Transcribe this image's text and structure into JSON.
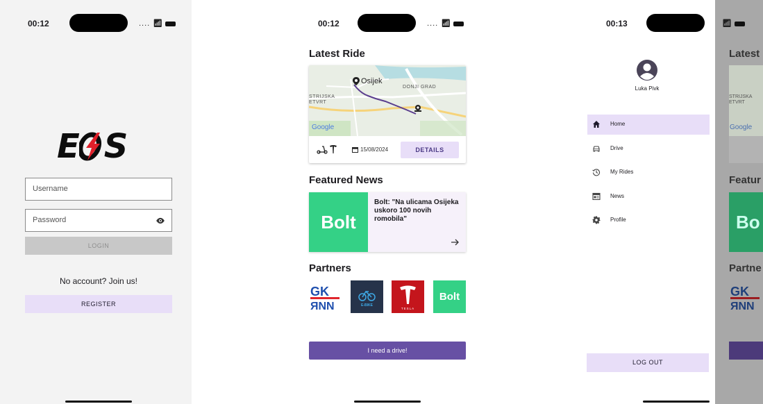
{
  "screens": {
    "login": {
      "status_time": "00:12",
      "logo_left": "E",
      "logo_right": "S",
      "username_placeholder": "Username",
      "password_placeholder": "Password",
      "login_label": "LOGIN",
      "join_text": "No account? Join us!",
      "register_label": "REGISTER"
    },
    "dashboard": {
      "status_time": "00:12",
      "latest_ride_title": "Latest Ride",
      "map": {
        "city_label": "Osijek",
        "district_label": "DONJI GRAD",
        "area_label_1": "STRIJSKA",
        "area_label_2": "ETVRT",
        "provider": "Google"
      },
      "ride_date": "15/08/2024",
      "details_label": "DETAILS",
      "featured_news_title": "Featured News",
      "news_brand": "Bolt",
      "news_headline": "Bolt: \"Na ulicama Osijeka uskoro 100 novih romobila\"",
      "partners_title": "Partners",
      "partners": [
        {
          "name": "GK",
          "caption": ""
        },
        {
          "name": "E-BIKE",
          "caption": "E-BIKE"
        },
        {
          "name": "TESLA",
          "caption": "TESLA"
        },
        {
          "name": "Bolt",
          "caption": "Bolt"
        }
      ],
      "drive_button_label": "I need a drive!"
    },
    "drawer": {
      "status_time": "00:13",
      "user_name": "Luka Pivk",
      "nav_items": [
        {
          "label": "Home",
          "icon": "home-icon",
          "active": true
        },
        {
          "label": "Drive",
          "icon": "car-icon",
          "active": false
        },
        {
          "label": "My Rides",
          "icon": "history-icon",
          "active": false
        },
        {
          "label": "News",
          "icon": "newspaper-icon",
          "active": false
        },
        {
          "label": "Profile",
          "icon": "gear-icon",
          "active": false
        }
      ],
      "logout_label": "LOG OUT",
      "behind": {
        "latest_title": "Latest",
        "featured_title": "Featur",
        "partners_title": "Partne",
        "bolt_fragment": "Bo"
      }
    }
  },
  "colors": {
    "primary": "#6750a4",
    "tonal": "#e8def8",
    "bolt_green": "#34d186",
    "tesla_red": "#c4151c",
    "route_purple": "#5b3e8e"
  }
}
